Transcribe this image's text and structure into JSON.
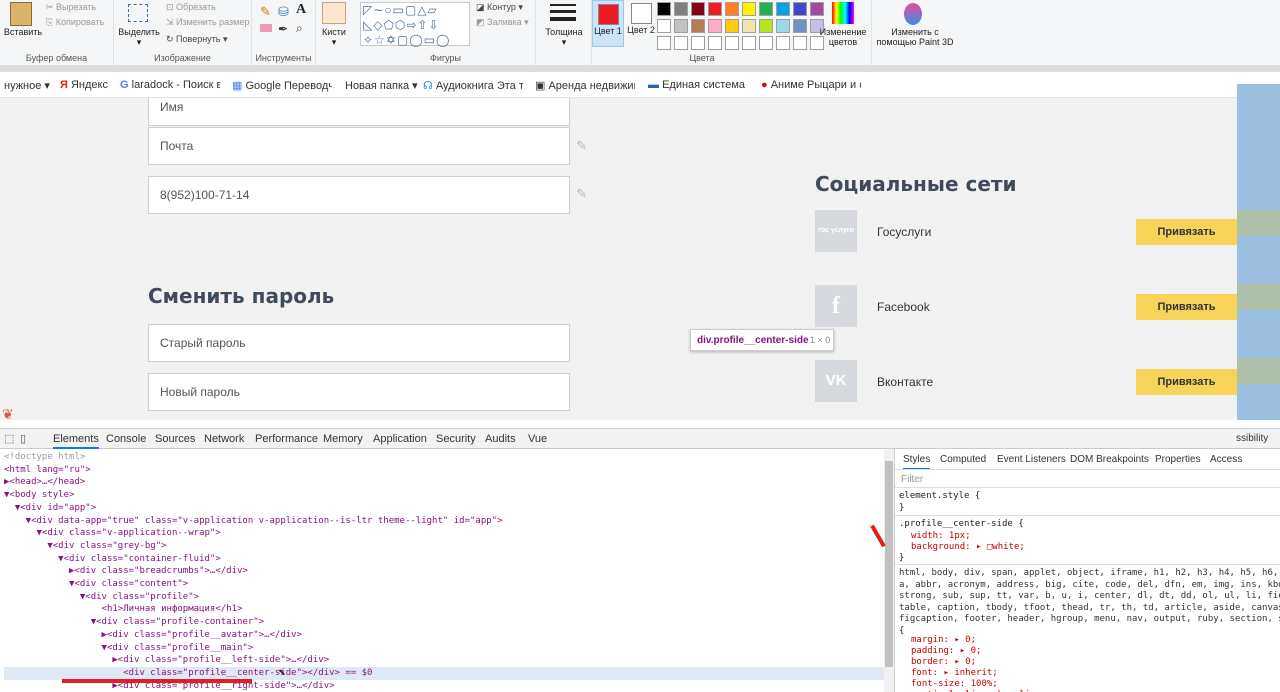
{
  "ribbon": {
    "clipboard": {
      "paste_label": "Вставить",
      "cut": "Вырезать",
      "copy": "Копировать",
      "group": "Буфер обмена"
    },
    "image": {
      "select_label": "Выделить",
      "crop": "Обрезать",
      "resize": "Изменить размер",
      "rotate": "Повернуть",
      "group": "Изображение"
    },
    "tools": {
      "group": "Инструменты"
    },
    "brushes": {
      "label": "Кисти"
    },
    "shapes": {
      "outline": "Контур",
      "fill": "Заливка",
      "group": "Фигуры"
    },
    "size": {
      "label": "Толщина"
    },
    "colors": {
      "color1_label": "Цвет 1",
      "color2_label": "Цвет 2",
      "group": "Цвета",
      "edit_label": "Изменение цветов",
      "paint3d_label": "Изменить с помощью Paint 3D",
      "color1": "#ed1c24",
      "color2": "#ffffff",
      "palette_row1": [
        "#000000",
        "#7f7f7f",
        "#880015",
        "#ed1c24",
        "#ff7f27",
        "#fff200",
        "#22b14c",
        "#00a2e8",
        "#3f48cc",
        "#a349a4"
      ],
      "palette_row2": [
        "#ffffff",
        "#c3c3c3",
        "#b97a57",
        "#ffaec9",
        "#ffc90e",
        "#efe4b0",
        "#b5e61d",
        "#99d9ea",
        "#7092be",
        "#c8bfe7"
      ]
    }
  },
  "bookmarks": [
    "нужное",
    "Яндекс",
    "laradock - Поиск в",
    "Google Переводч",
    "Новая папка",
    "Аудиокнига Эта те",
    "Аренда недвижим",
    "Единая система и",
    "Аниме Рыцари и с"
  ],
  "profile": {
    "fields": [
      "Имя",
      "Почта",
      "8(952)100-71-14"
    ],
    "password_title": "Сменить пароль",
    "password_fields": [
      "Старый пароль",
      "Новый пароль"
    ],
    "social_title": "Социальные сети",
    "socials": [
      {
        "name": "Госуслуги",
        "icon": "gosuslugi-icon",
        "icon_text": "гос услуги",
        "button": "Привязать"
      },
      {
        "name": "Facebook",
        "icon": "facebook-icon",
        "icon_text": "f",
        "button": "Привязать"
      },
      {
        "name": "Вконтакте",
        "icon": "vk-icon",
        "icon_text": "VK",
        "button": "Привязать"
      }
    ],
    "tooltip": {
      "selector": "div.profile__center-side",
      "size": "1 × 0"
    }
  },
  "devtools": {
    "tabs": [
      "Elements",
      "Console",
      "Sources",
      "Network",
      "Performance",
      "Memory",
      "Application",
      "Security",
      "Audits",
      "Vue"
    ],
    "dom_lines": [
      "<!doctype html>",
      "<html lang=\"ru\">",
      "▶<head>…</head>",
      "▼<body style>",
      "  ▼<div id=\"app\">",
      "    ▼<div data-app=\"true\" class=\"v-application v-application--is-ltr theme--light\" id=\"app\">",
      "      ▼<div class=\"v-application--wrap\">",
      "        ▼<div class=\"grey-bg\">",
      "          ▼<div class=\"container-fluid\">",
      "            ▶<div class=\"breadcrumbs\">…</div>",
      "            ▼<div class=\"content\">",
      "              ▼<div class=\"profile\">",
      "                  <h1>Личная информация</h1>",
      "                ▼<div class=\"profile-container\">",
      "                  ▶<div class=\"profile__avatar\">…</div>",
      "                  ▼<div class=\"profile__main\">",
      "                    ▶<div class=\"profile__left-side\">…</div>",
      "                      <div class=\"profile__center-side\"></div> == $0",
      "                    ▶<div class=\"profile__right-side\">…</div>"
    ],
    "styles_tabs": [
      "Styles",
      "Computed",
      "Event Listeners",
      "DOM Breakpoints",
      "Properties",
      "Access"
    ],
    "filter_placeholder": "Filter",
    "element_style": "element.style {",
    "rule_selector": ".profile__center-side {",
    "rule_props": [
      "width: 1px;",
      "background: ▸ □white;"
    ],
    "reset_selectors": "html, body, div, span, applet, object, iframe, h1, h2, h3, h4, h5, h6, p, bl\na, abbr, acronym, address, big, cite, code, del, dfn, em, img, ins, kbd, q,\nstrong, sub, sup, tt, var, b, u, i, center, dl, dt, dd, ol, ul, li, fieldset\ntable, caption, tbody, tfoot, thead, tr, th, td, article, aside, canvas, det\nfigcaption, footer, header, hgroup, menu, nav, output, ruby, section, summar",
    "reset_props": [
      "margin: ▸ 0;",
      "padding: ▸ 0;",
      "border: ▸ 0;",
      "font: ▸ inherit;",
      "font-size: 100%;",
      "vertical-align: baseline;"
    ],
    "accessibility_tab": "ssibility"
  }
}
